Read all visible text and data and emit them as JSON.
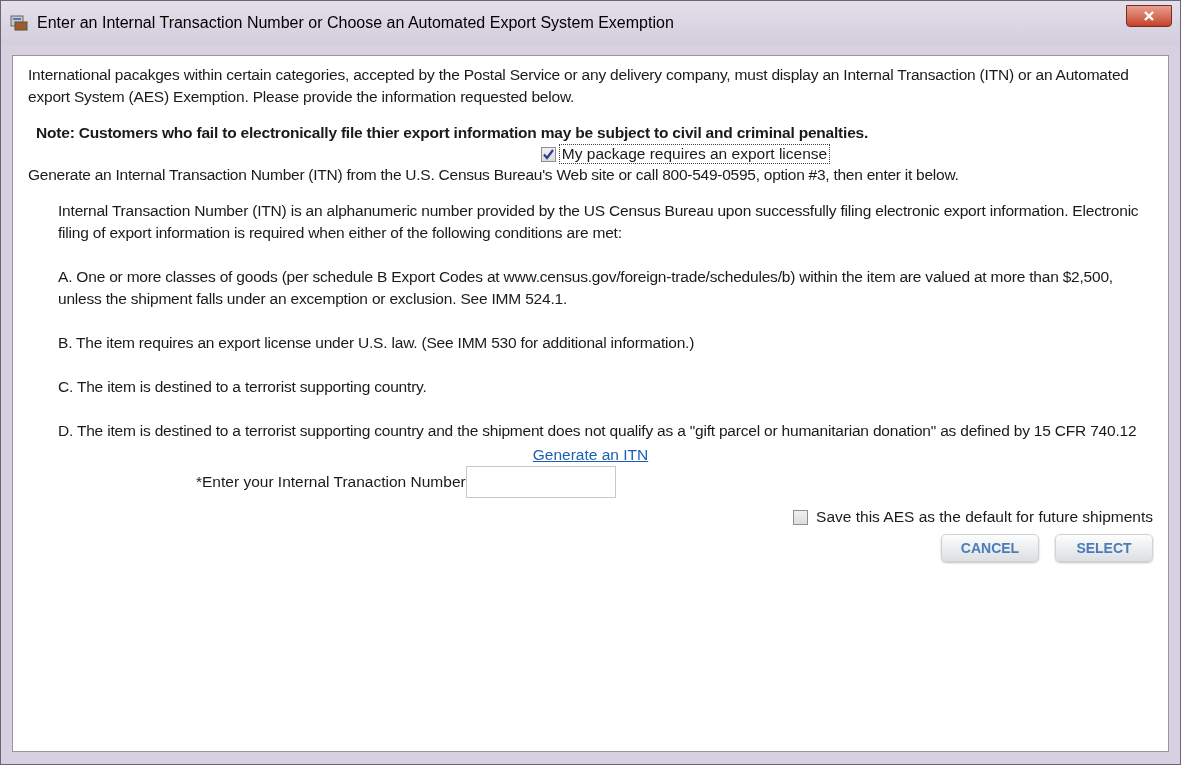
{
  "window": {
    "title": "Enter an Internal Transaction Number or Choose an Automated Export System Exemption"
  },
  "intro": "International pacakges within certain categories, accepted by the Postal Service or any delivery company, must display an Internal Transaction (ITN) or an Automated export System (AES) Exemption. Please provide the information requested below.",
  "note": "Note: Customers who fail to electronically file thier export information may be subject to civil and criminal penalties.",
  "export_license": {
    "label": "My package requires an export license",
    "checked": true
  },
  "generate_hint": "Generate an Internal Transaction Number (ITN) from the U.S. Census Bureau's Web site or call 800-549-0595, option #3, then enter it below.",
  "info_paragraphs": [
    "Internal Transaction Number (ITN) is an alphanumeric number provided by the US Census Bureau upon successfully filing electronic export information. Electronic filing of export information is required when either of the following conditions are met:",
    "A. One or more classes of goods (per schedule B Export Codes at www.census.gov/foreign-trade/schedules/b) within the item are valued at more than $2,500, unless the shipment falls under an excemption or exclusion. See IMM 524.1.",
    "B. The item requires an export license under U.S. law. (See IMM 530 for additional information.)",
    "C. The item is destined to a terrorist supporting country.",
    "D. The item is destined to a terrorist supporting country and the shipment does not qualify as a \"gift parcel or humanitarian donation\" as defined by 15 CFR 740.12"
  ],
  "generate_link": "Generate an ITN",
  "itn_field": {
    "label": "*Enter your Internal Tranaction Number"
  },
  "save_default": {
    "label": "Save this AES as the default for future shipments",
    "checked": false
  },
  "buttons": [
    "CANCEL",
    "SELECT"
  ]
}
